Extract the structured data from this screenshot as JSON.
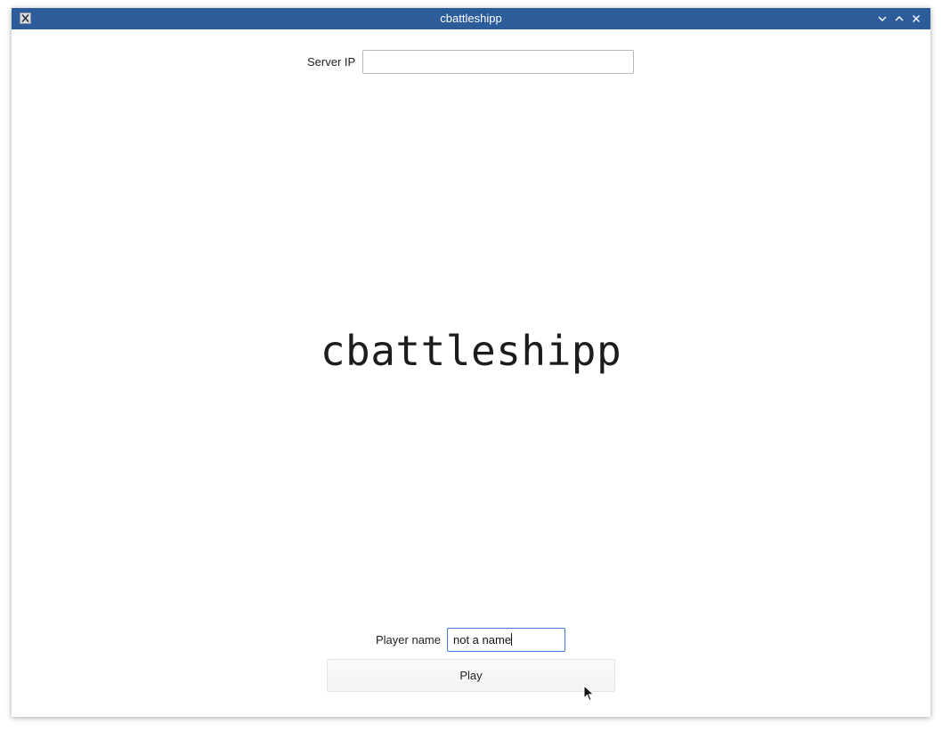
{
  "window": {
    "title": "cbattleshipp"
  },
  "icons": {
    "app": "x11-app-icon",
    "minimize": "chevron-down-icon",
    "maximize": "chevron-up-icon",
    "close": "close-icon",
    "cursor": "mouse-pointer-icon"
  },
  "server": {
    "label": "Server IP",
    "value": "",
    "placeholder": ""
  },
  "main": {
    "title": "cbattleshipp"
  },
  "player": {
    "label": "Player name",
    "value": "not a name"
  },
  "play": {
    "label": "Play"
  },
  "colors": {
    "titlebar": "#2d5c9a",
    "focus_border": "#3a7bd5"
  }
}
